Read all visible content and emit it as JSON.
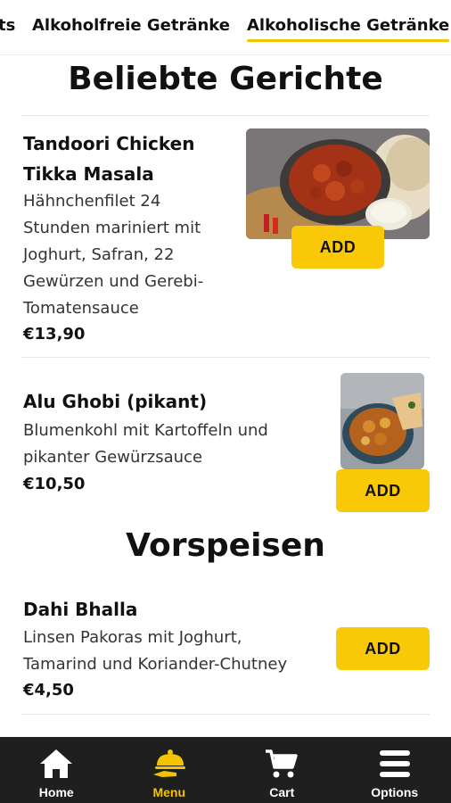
{
  "tabs": {
    "items": [
      {
        "label": "ts"
      },
      {
        "label": "Alkoholfreie Getränke"
      },
      {
        "label": "Alkoholische Getränke"
      }
    ],
    "active_index": 2
  },
  "sections": [
    {
      "title": "Beliebte Gerichte",
      "items": [
        {
          "name_line1": "Tandoori Chicken",
          "name_line2": "Tikka Masala",
          "desc": [
            "Hähnchenfilet 24",
            "Stunden mariniert mit",
            "Joghurt, Safran, 22",
            "Gewürzen und Gerebi-",
            "Tomatensauce"
          ],
          "price": "€13,90",
          "add_label": "ADD",
          "image": "tikka-masala-photo"
        },
        {
          "name_line1": "Alu Ghobi (pikant)",
          "desc": [
            "Blumenkohl mit Kartoffeln und",
            "pikanter Gewürzsauce"
          ],
          "price": "€10,50",
          "add_label": "ADD",
          "image": "alu-gobi-photo"
        }
      ]
    },
    {
      "title": "Vorspeisen",
      "items": [
        {
          "name_line1": "Dahi Bhalla",
          "desc": [
            "Linsen Pakoras mit Joghurt,",
            "Tamarind und Koriander-Chutney"
          ],
          "price": "€4,50",
          "add_label": "ADD"
        }
      ]
    }
  ],
  "bottom_nav": {
    "items": [
      {
        "label": "Home",
        "icon": "home-icon"
      },
      {
        "label": "Menu",
        "icon": "cloche-icon"
      },
      {
        "label": "Cart",
        "icon": "cart-icon"
      },
      {
        "label": "Options",
        "icon": "menu-icon"
      }
    ],
    "active_index": 1
  },
  "colors": {
    "accent": "#f9c908",
    "nav_bg": "#1f1f1f",
    "active_label": "#f5c400"
  }
}
